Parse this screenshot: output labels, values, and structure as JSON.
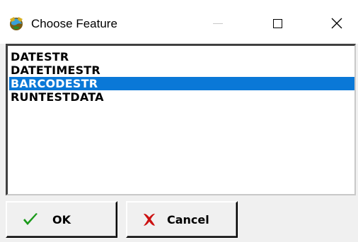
{
  "window": {
    "title": "Choose Feature",
    "icon": "app-globe-icon",
    "controls": {
      "minimize": "minimize-icon",
      "maximize": "maximize-icon",
      "close": "close-icon"
    }
  },
  "list": {
    "items": [
      {
        "label": "DATESTR",
        "selected": false
      },
      {
        "label": "DATETIMESTR",
        "selected": false
      },
      {
        "label": "BARCODESTR",
        "selected": true
      },
      {
        "label": "RUNTESTDATA",
        "selected": false
      }
    ],
    "selection_color": "#0a78d7"
  },
  "buttons": {
    "ok": {
      "label": "OK",
      "icon": "checkmark-icon",
      "icon_color": "#1a9a1a"
    },
    "cancel": {
      "label": "Cancel",
      "icon": "x-icon",
      "icon_color": "#cc1010"
    }
  }
}
